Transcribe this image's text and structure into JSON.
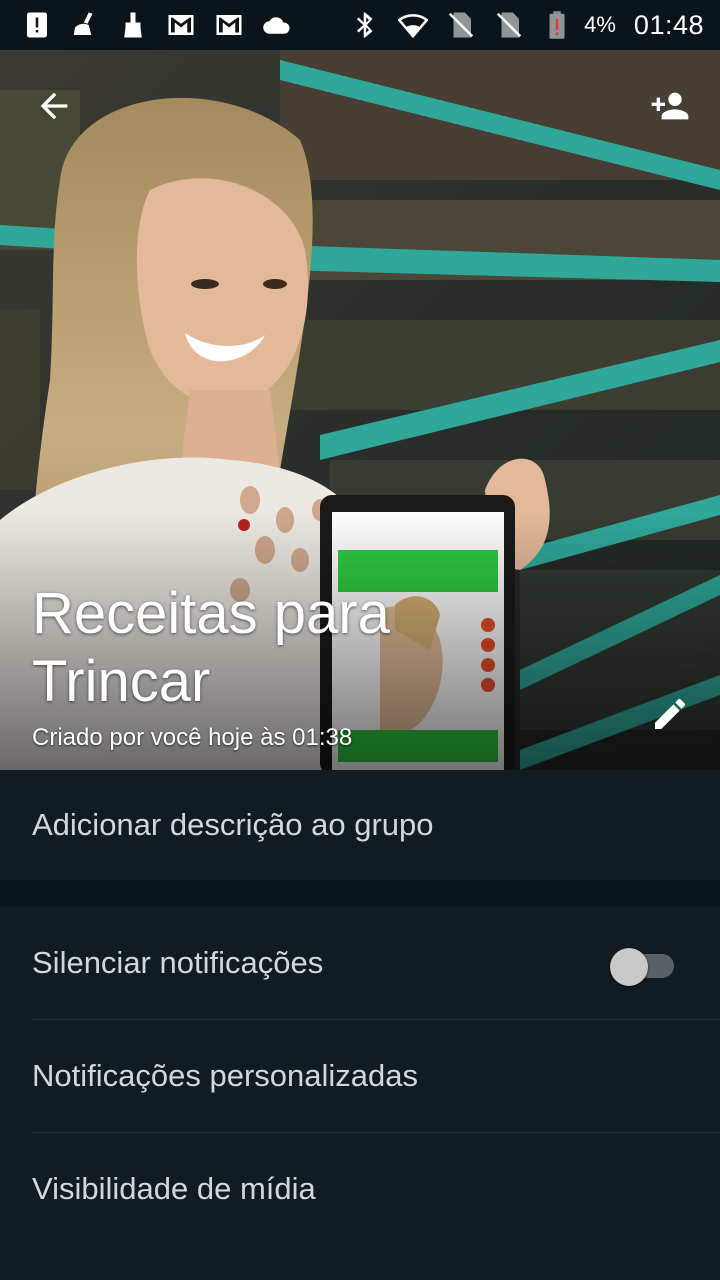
{
  "status_bar": {
    "battery_percent": "4%",
    "time": "01:48",
    "left_icons": [
      "alert-icon",
      "cleaner-icon",
      "brush-icon",
      "gmail-icon",
      "gmail-icon",
      "cloud-icon"
    ],
    "right_icons": [
      "bluetooth-icon",
      "wifi-icon",
      "no-sim-icon",
      "no-sim-icon",
      "battery-low-icon"
    ]
  },
  "header": {
    "title": "Receitas para Trincar",
    "subtitle": "Criado por você hoje às 01:38",
    "icons": [
      "arrow-back-icon",
      "add-person-icon",
      "edit-pencil-icon"
    ]
  },
  "description": {
    "label": "Adicionar descrição ao grupo"
  },
  "settings": {
    "mute": {
      "label": "Silenciar notificações",
      "enabled": false
    },
    "custom_notifications": {
      "label": "Notificações personalizadas"
    },
    "media_visibility": {
      "label": "Visibilidade de mídia"
    }
  },
  "colors": {
    "background": "#0b141a",
    "row_background": "#111b21",
    "text_primary": "#d1d7db"
  }
}
